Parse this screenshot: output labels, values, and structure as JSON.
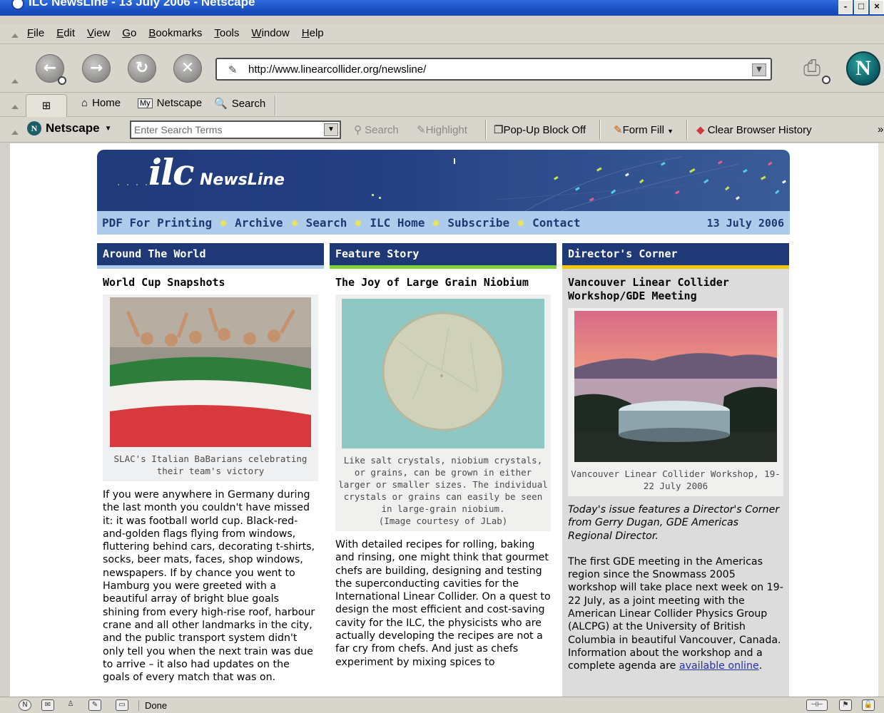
{
  "window": {
    "title": "ILC NewsLine - 13 July 2006 - Netscape"
  },
  "menu": {
    "items": [
      "File",
      "Edit",
      "View",
      "Go",
      "Bookmarks",
      "Tools",
      "Window",
      "Help"
    ]
  },
  "nav": {
    "url": "http://www.linearcollider.org/newsline/"
  },
  "personal": {
    "home": "Home",
    "my": "My",
    "netscape": "Netscape",
    "search": "Search"
  },
  "searchbar": {
    "brand": "Netscape",
    "placeholder": "Enter Search Terms",
    "search": "Search",
    "highlight": "Highlight",
    "popup": "Pop-Up Block Off",
    "formfill": "Form Fill",
    "clear": "Clear Browser History"
  },
  "newsletter": {
    "logo": "ilc",
    "title": "NewsLine",
    "nav": [
      "PDF For Printing",
      "Archive",
      "Search",
      "ILC Home",
      "Subscribe",
      "Contact"
    ],
    "date": "13 July 2006",
    "colors": {
      "navy": "#1f3876",
      "lightblue": "#aecbec",
      "yellow": "#e8e35a",
      "green": "#7ed13a",
      "gold": "#f2c70c"
    }
  },
  "columns": {
    "around": {
      "header": "Around The World",
      "title": "World Cup Snapshots",
      "caption": "SLAC's Italian BaBarians celebrating their team's victory",
      "body": "If you were anywhere in Germany during the last month you couldn't have missed it: it was football world cup. Black-red-and-golden flags flying from windows, fluttering behind cars, decorating t-shirts, socks, beer mats, faces, shop windows, newspapers. If by chance you went to Hamburg you were greeted with a beautiful array of bright blue goals shining from every high-rise roof, harbour crane and all other landmarks in the city, and the public transport system didn't only tell you when the next train was due to arrive – it also had updates on the goals of every match that was on."
    },
    "feature": {
      "header": "Feature Story",
      "title": "The Joy of Large Grain Niobium",
      "caption": "Like salt crystals, niobium crystals, or grains, can be grown in either larger or smaller sizes. The individual crystals or grains can easily be seen in large-grain niobium.",
      "credit": "(Image courtesy of JLab)",
      "body": "With detailed recipes for rolling, baking and rinsing, one might think that gourmet chefs are building, designing and testing the superconducting cavities for the International Linear Collider. On a quest to design the most efficient and cost-saving cavity for the ILC, the physicists who are actually developing the recipes are not a far cry from chefs. And just as chefs experiment by mixing spices to"
    },
    "director": {
      "header": "Director's Corner",
      "title": "Vancouver Linear Collider Workshop/GDE Meeting",
      "caption": "Vancouver Linear Collider Workshop, 19-22 July 2006",
      "intro": "Today's issue features a Director's Corner from Gerry Dugan, GDE Americas Regional Director.",
      "body": "The first GDE meeting in the Americas region since the Snowmass 2005 workshop will take place next week on 19-22 July, as a joint meeting with the American Linear Collider Physics Group (ALCPG) at the University of British Columbia in beautiful Vancouver, Canada. Information about the workshop and a complete agenda are",
      "link": "available online",
      "end": "."
    }
  },
  "status": {
    "text": "Done"
  }
}
